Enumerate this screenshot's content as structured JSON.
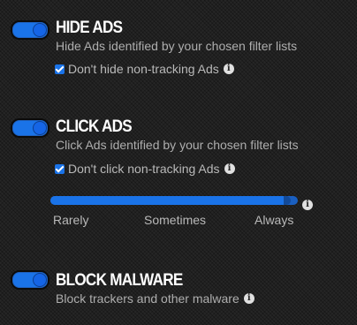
{
  "sections": [
    {
      "title": "HIDE ADS",
      "description": "Hide Ads identified by your chosen filter lists",
      "toggle_on": true,
      "option": {
        "label": "Don't hide non-tracking Ads",
        "checked": true,
        "info_icon": "info-icon"
      }
    },
    {
      "title": "CLICK ADS",
      "description": "Click Ads identified by your chosen filter lists",
      "toggle_on": true,
      "option": {
        "label": "Don't click non-tracking Ads",
        "checked": true,
        "info_icon": "info-icon"
      },
      "frequency_slider": {
        "labels": [
          "Rarely",
          "Sometimes",
          "Always"
        ],
        "value_fraction": 0.97,
        "info_icon": "info-icon"
      }
    },
    {
      "title": "BLOCK MALWARE",
      "description": "Block trackers and other malware",
      "toggle_on": true,
      "info_icon": "info-icon"
    }
  ],
  "colors": {
    "accent": "#1a73e8",
    "background": "#262626",
    "title": "#ffffff",
    "text": "#aeaeae"
  },
  "info_glyph": "i"
}
